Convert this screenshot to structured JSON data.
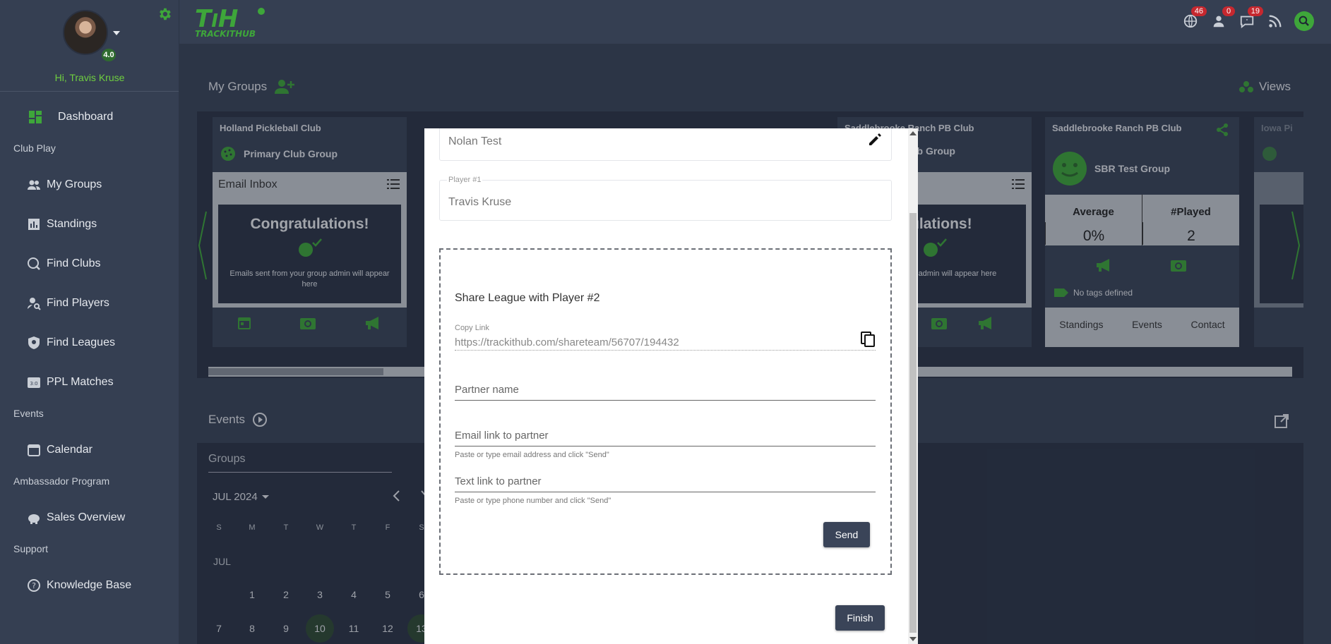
{
  "sidebar": {
    "greeting": "Hi, Travis Kruse",
    "rating": "4.0",
    "sections": {
      "club_play": "Club Play",
      "events": "Events",
      "ambassador": "Ambassador Program",
      "support": "Support"
    },
    "items": {
      "dashboard": "Dashboard",
      "my_groups": "My Groups",
      "standings": "Standings",
      "find_clubs": "Find Clubs",
      "find_players": "Find Players",
      "find_leagues": "Find Leagues",
      "ppl_matches": "PPL Matches",
      "calendar": "Calendar",
      "sales_overview": "Sales Overview",
      "knowledge_base": "Knowledge Base"
    }
  },
  "topbar": {
    "logo_text": "TH",
    "logo_sub": "TRACKITHUB",
    "badges": {
      "globe": "46",
      "user": "0",
      "chat": "19"
    },
    "accent": "#3ea63a"
  },
  "groups_panel": {
    "title": "My Groups",
    "views_label": "Views",
    "cards": [
      {
        "club": "Holland Pickleball Club",
        "group": "Primary Club Group",
        "inbox_title": "Email Inbox",
        "congrats_title": "Congratulations!",
        "congrats_text": "Emails sent from your group admin will appear here"
      },
      {
        "club": "Saddlebrooke Ranch PB Club",
        "group": "Club Group",
        "congrats_title": "atulations!",
        "congrats_text": "n your group admin will appear here"
      },
      {
        "club": "Saddlebrooke Ranch PB Club",
        "group": "SBR Test Group",
        "stats": {
          "average_label": "Average",
          "average_value": "0%",
          "played_label": "#Played",
          "played_value": "2"
        },
        "tags": "No tags defined",
        "links": {
          "standings": "Standings",
          "events": "Events",
          "contact": "Contact"
        }
      },
      {
        "club": "Iowa Pi"
      }
    ]
  },
  "events_panel": {
    "title": "Events",
    "groups_label": "Groups",
    "month": "JUL 2024",
    "dow": [
      "S",
      "M",
      "T",
      "W",
      "T",
      "F",
      "S"
    ],
    "month_label": "JUL",
    "week1": [
      "1",
      "2",
      "3",
      "4",
      "5",
      "6"
    ],
    "week2": [
      "7",
      "8",
      "9",
      "10",
      "11",
      "12",
      "13"
    ]
  },
  "modal": {
    "team_name": "Nolan Test",
    "player1_label": "Player #1",
    "player1_value": "Travis Kruse",
    "share_title": "Share League with Player #2",
    "copy_label": "Copy Link",
    "copy_url": "https://trackithub.com/shareteam/56707/194432",
    "partner_placeholder": "Partner name",
    "email_placeholder": "Email link to partner",
    "email_hint": "Paste or type email address and click \"Send\"",
    "text_placeholder": "Text link to partner",
    "text_hint": "Paste or type phone number and click \"Send\"",
    "send_label": "Send",
    "finish_label": "Finish"
  }
}
